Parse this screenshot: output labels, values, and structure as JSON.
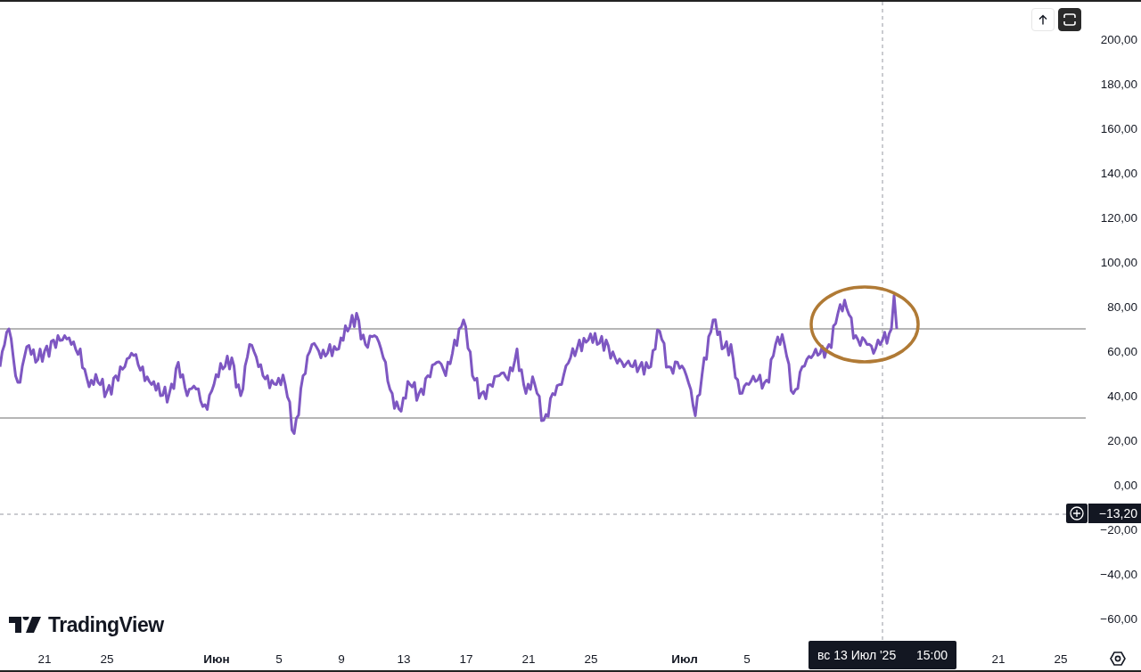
{
  "toolbar": {
    "buttons": [
      {
        "kind": "scroll-up",
        "selected": false
      },
      {
        "kind": "fullscreen",
        "selected": true
      }
    ]
  },
  "logo": {
    "text": "TradingView"
  },
  "price_axis": {
    "labels": [
      "200,00",
      "180,00",
      "160,00",
      "140,00",
      "120,00",
      "100,00",
      "80,00",
      "60,00",
      "40,00",
      "20,00",
      "0,00",
      "−20,00",
      "−40,00",
      "−60,00"
    ]
  },
  "time_axis": {
    "labels": [
      {
        "text": "21",
        "kind": "day"
      },
      {
        "text": "25",
        "kind": "day"
      },
      {
        "text": "Июн",
        "kind": "month"
      },
      {
        "text": "5",
        "kind": "day"
      },
      {
        "text": "9",
        "kind": "day"
      },
      {
        "text": "13",
        "kind": "day"
      },
      {
        "text": "17",
        "kind": "day"
      },
      {
        "text": "21",
        "kind": "day"
      },
      {
        "text": "25",
        "kind": "day"
      },
      {
        "text": "Июл",
        "kind": "month"
      },
      {
        "text": "5",
        "kind": "day"
      },
      {
        "text": "21",
        "kind": "day"
      },
      {
        "text": "25",
        "kind": "day"
      }
    ]
  },
  "crosshair": {
    "price_label": "−13,20",
    "date_label": "вс 13 Июл '25",
    "time_label": "15:00"
  }
}
